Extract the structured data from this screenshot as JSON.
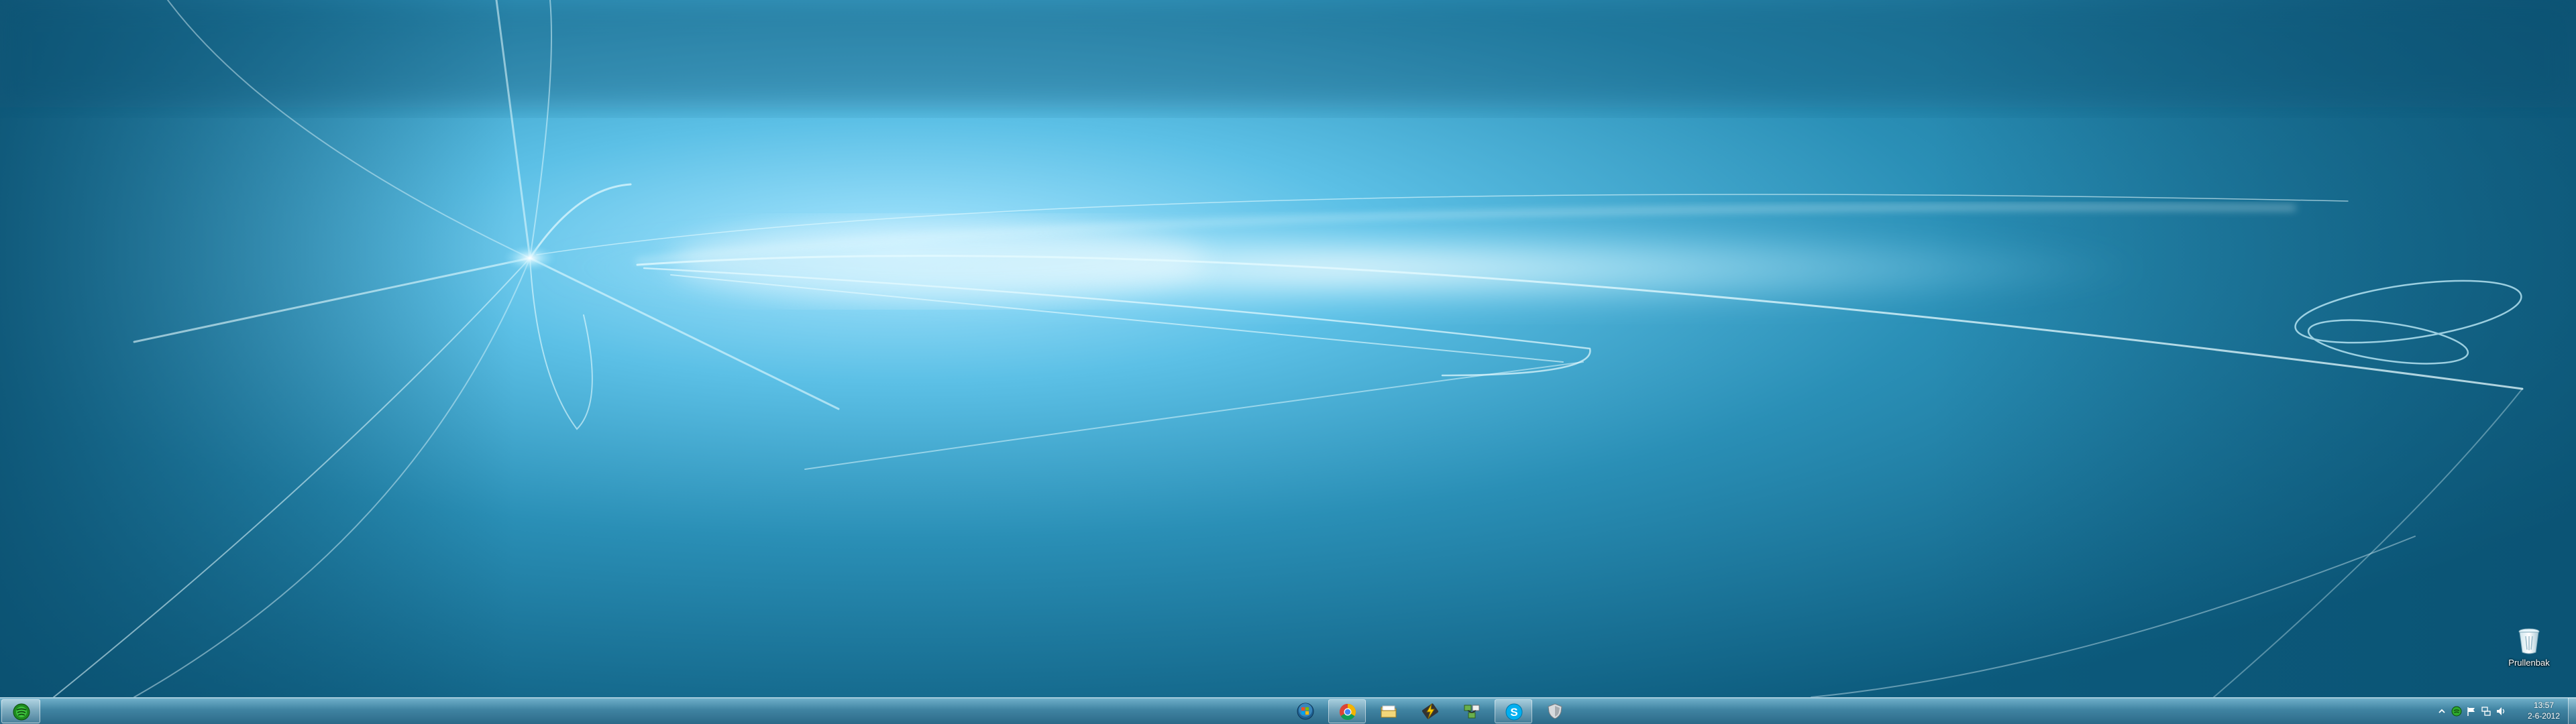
{
  "desktop": {
    "icons": [
      {
        "label": "Prullenbak",
        "icon": "recycle-bin-icon"
      }
    ]
  },
  "taskbar": {
    "start_app": {
      "icon": "green-disc-icon"
    },
    "pinned": [
      {
        "icon": "windows-orb-icon"
      },
      {
        "icon": "chrome-icon",
        "active": true
      },
      {
        "icon": "file-explorer-icon"
      },
      {
        "icon": "lightning-tool-icon"
      },
      {
        "icon": "network-map-icon"
      },
      {
        "icon": "skype-icon",
        "active": true
      },
      {
        "icon": "shield-icon"
      }
    ],
    "tray": {
      "icons": [
        "show-hidden-icons-arrow",
        "green-app-tray-icon",
        "action-center-flag-icon",
        "network-icon",
        "volume-icon"
      ],
      "time": "13:57",
      "date": "2-6-2012"
    }
  },
  "colors": {
    "wallpaper_base": "#0f6688",
    "wallpaper_glow": "#bff0ff",
    "taskbar": "#4f93b3"
  }
}
